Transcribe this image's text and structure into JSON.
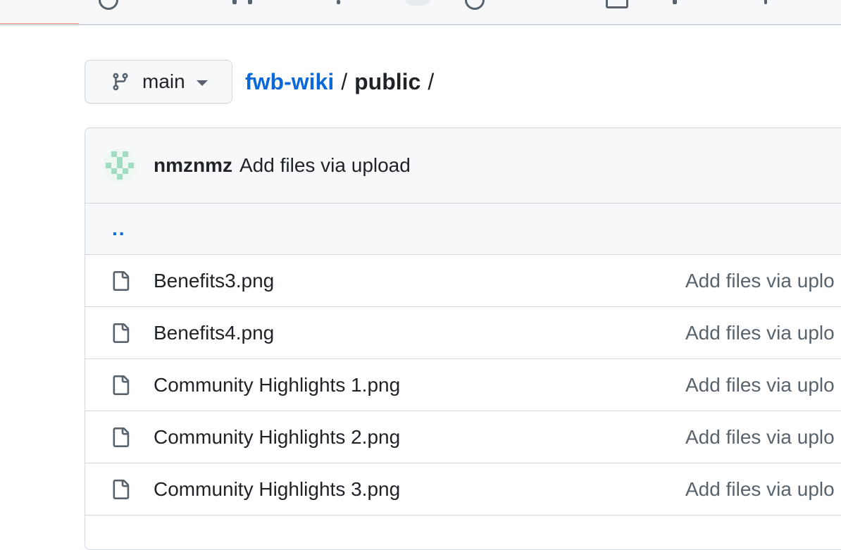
{
  "branch": {
    "name": "main"
  },
  "breadcrumb": {
    "repo": "fwb-wiki",
    "separator": "/",
    "current": "public",
    "trailing": "/"
  },
  "latest_commit": {
    "author": "nmznmz",
    "message": "Add files via upload"
  },
  "parent_dir": {
    "label": ".."
  },
  "files": [
    {
      "name": "Benefits3.png",
      "commit": "Add files via uplo"
    },
    {
      "name": "Benefits4.png",
      "commit": "Add files via uplo"
    },
    {
      "name": "Community Highlights 1.png",
      "commit": "Add files via uplo"
    },
    {
      "name": "Community Highlights 2.png",
      "commit": "Add files via uplo"
    },
    {
      "name": "Community Highlights 3.png",
      "commit": "Add files via uplo"
    }
  ],
  "icons": {
    "branch": "git-branch-icon",
    "file": "file-icon",
    "dropdown": "triangle-down-icon"
  },
  "colors": {
    "link": "#0969da",
    "muted": "#59636e",
    "border": "#d0d7de",
    "active_tab_underline": "#fd8c73"
  }
}
